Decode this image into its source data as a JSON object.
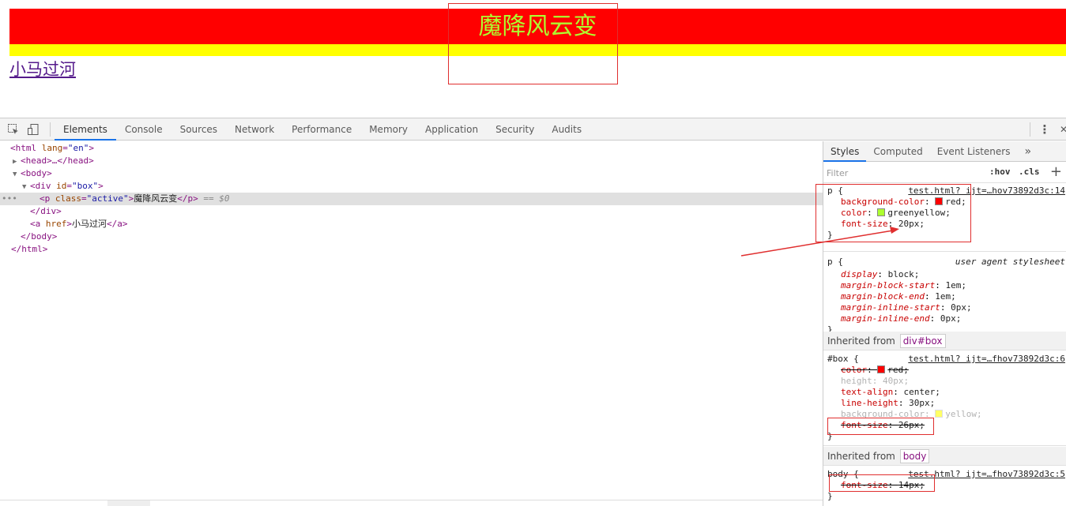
{
  "page": {
    "title_text": "魔降风云变",
    "link_text": "小马过河",
    "colors": {
      "box_bg": "#ffff00",
      "p_bg": "#ff0000",
      "p_color": "#adff2f",
      "annotation": "#e02f2f"
    }
  },
  "toolbar": {
    "icons": [
      "inspect-icon",
      "device-toggle-icon",
      "more-vertical-icon",
      "close-icon"
    ],
    "tabs": [
      "Elements",
      "Console",
      "Sources",
      "Network",
      "Performance",
      "Memory",
      "Application",
      "Security",
      "Audits"
    ],
    "selected_tab": "Elements",
    "kebab": "⋮",
    "close": "✕"
  },
  "dom": {
    "html_open": "<html",
    "html_lang_attr": "lang",
    "html_lang_val": "\"en\"",
    "gt": ">",
    "head": "<head>…</head>",
    "body_open": "<body>",
    "div_open": "<div",
    "div_id_attr": "id",
    "div_id_val": "\"box\"",
    "p_open": "<p",
    "p_class_attr": "class",
    "p_class_val": "\"active\"",
    "p_text": "魔降风云变",
    "p_close": "</p>",
    "sel_marker": "== $0",
    "div_close": "</div>",
    "a_open": "<a",
    "a_href_attr": "href",
    "a_text": "小马过河",
    "a_close": "</a>",
    "body_close": "</body>",
    "html_close": "</html>",
    "ellipsis": "•••"
  },
  "styles_pane": {
    "tabs": [
      "Styles",
      "Computed",
      "Event Listeners",
      "»"
    ],
    "filter_placeholder": "Filter",
    "hov": ":hov",
    "cls": ".cls",
    "plus": "+",
    "rule1": {
      "selector": "p {",
      "source": "test.html? ijt=…hov73892d3c:14",
      "decls": [
        {
          "prop": "background-color",
          "value": "red;",
          "swatch": "#ff0000"
        },
        {
          "prop": "color",
          "value": "greenyellow;",
          "swatch": "#adff2f"
        },
        {
          "prop": "font-size",
          "value": "20px;"
        }
      ],
      "close": "}"
    },
    "rule2": {
      "selector": "p {",
      "source": "user agent stylesheet",
      "decls": [
        {
          "prop": "display",
          "value": "block;"
        },
        {
          "prop": "margin-block-start",
          "value": "1em;"
        },
        {
          "prop": "margin-block-end",
          "value": "1em;"
        },
        {
          "prop": "margin-inline-start",
          "value": "0px;"
        },
        {
          "prop": "margin-inline-end",
          "value": "0px;"
        }
      ],
      "close": "}"
    },
    "inherited1": {
      "label": "Inherited from",
      "badge": "div#box"
    },
    "rule3": {
      "selector": "#box {",
      "source": "test.html? ijt=…fhov73892d3c:6",
      "decls": [
        {
          "prop": "color",
          "value": "red;",
          "swatch": "#ff0000",
          "struck": true
        },
        {
          "prop": "height",
          "value": "40px;",
          "dim": true
        },
        {
          "prop": "text-align",
          "value": "center;"
        },
        {
          "prop": "line-height",
          "value": "30px;"
        },
        {
          "prop": "background-color",
          "value": "yellow;",
          "swatch": "#ffff00",
          "dim": true
        },
        {
          "prop": "font-size",
          "value": "26px;",
          "struck": true
        }
      ],
      "close": "}"
    },
    "inherited2": {
      "label": "Inherited from",
      "badge": "body"
    },
    "rule4": {
      "selector": "body {",
      "source": "test.html? ijt=…fhov73892d3c:5",
      "decls": [
        {
          "prop": "font-size",
          "value": "14px;",
          "struck": true
        }
      ],
      "close": "}"
    }
  }
}
